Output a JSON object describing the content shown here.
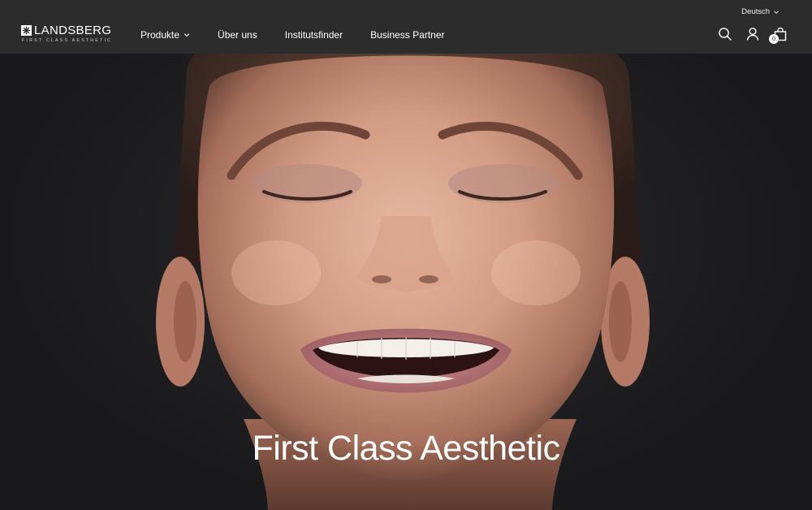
{
  "header": {
    "language": "Deutsch",
    "logo": {
      "brand": "LANDSBERG",
      "tagline": "FIRST CLASS AESTHETIC"
    },
    "nav": [
      {
        "label": "Produkte",
        "has_dropdown": true
      },
      {
        "label": "Über uns",
        "has_dropdown": false
      },
      {
        "label": "Institutsfinder",
        "has_dropdown": false
      },
      {
        "label": "Business Partner",
        "has_dropdown": false
      }
    ],
    "icons": [
      "search-icon",
      "account-icon",
      "cart-icon"
    ],
    "cart_count": "0"
  },
  "hero": {
    "title": "First Class Aesthetic",
    "image": "smiling-woman-portrait"
  },
  "colors": {
    "header_bg": "#2c2c2c",
    "hero_bg": "#1c1c1e",
    "text": "#ffffff"
  }
}
